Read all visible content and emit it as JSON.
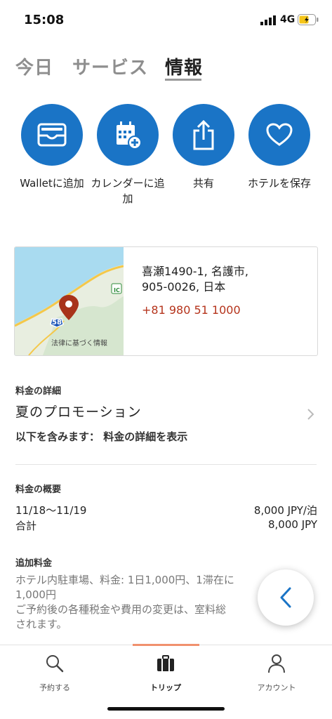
{
  "status_bar": {
    "time": "15:08",
    "network": "4G"
  },
  "tabs": [
    {
      "label": "今日"
    },
    {
      "label": "サービス"
    },
    {
      "label": "情報"
    }
  ],
  "actions": [
    {
      "label": "Walletに追加",
      "icon": "wallet-icon"
    },
    {
      "label": "カレンダーに追加",
      "icon": "calendar-add-icon"
    },
    {
      "label": "共有",
      "icon": "share-icon"
    },
    {
      "label": "ホテルを保存",
      "icon": "heart-icon"
    }
  ],
  "location": {
    "address_line1": "喜瀬1490-1, 名護市,",
    "address_line2": "905-0026, 日本",
    "phone": "+81 980 51 1000",
    "map_legal": "法律に基づく情報",
    "route_number": "58",
    "interchange": "IC"
  },
  "rate_details": {
    "title": "料金の詳細",
    "name": "夏のプロモーション",
    "includes": "以下を含みます： 料金の詳細を表示"
  },
  "rate_summary": {
    "title": "料金の概要",
    "dates": "11/18〜11/19",
    "per_night": "8,000 JPY/泊",
    "total_label": "合計",
    "total_value": "8,000 JPY"
  },
  "extra_charges": {
    "title": "追加料金",
    "line1": "ホテル内駐車場、料金: 1日1,000円、1滞在に",
    "line2": "1,000円",
    "line3": "ご予約後の各種税金や費用の変更は、室料総",
    "line4": "されます。"
  },
  "bottom_nav": [
    {
      "label": "予約する",
      "icon": "search-icon"
    },
    {
      "label": "トリップ",
      "icon": "suitcase-icon"
    },
    {
      "label": "アカウント",
      "icon": "person-icon"
    }
  ],
  "colors": {
    "accent_blue": "#1a74c6",
    "phone_red": "#b5341c",
    "nav_indicator": "#f0916e"
  }
}
